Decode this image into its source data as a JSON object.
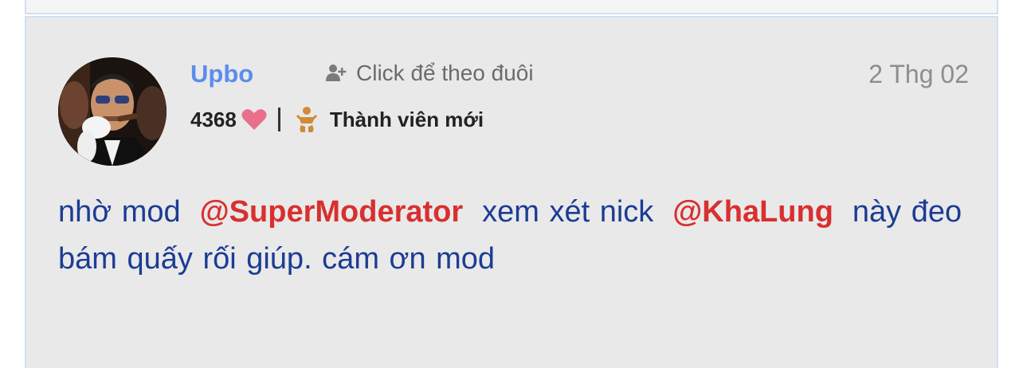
{
  "post": {
    "username": "Upbo",
    "follow_label": "Click để theo đuôi",
    "date": "2 Thg 02",
    "points": "4368",
    "rank": "Thành viên mới",
    "content": {
      "part1": "nhờ mod",
      "mention1": "@SuperModerator",
      "part2": "xem xét nick",
      "mention2": "@KhaLung",
      "part3": "này đeo bám quấy rối giúp. cám ơn mod"
    }
  },
  "colors": {
    "username": "#5b8def",
    "mention": "#d92f2f",
    "content_text": "#1c3c94",
    "post_bg": "#e9e9e9",
    "heart": "#e8708a",
    "rank_icon": "#d08a3a"
  },
  "icons": {
    "follow": "user-plus-icon",
    "points": "heart-icon",
    "rank": "baby-icon"
  }
}
